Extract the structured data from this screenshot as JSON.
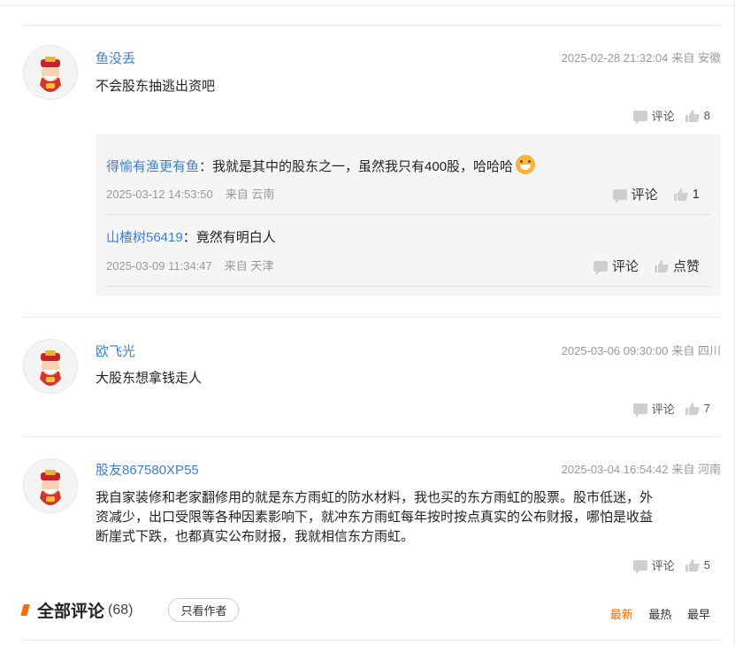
{
  "comments": [
    {
      "user": "鱼没丢",
      "time": "2025-02-28 21:32:04",
      "location": "来自 安徽",
      "text": "不会股东抽逃出资吧",
      "comment_label": "评论",
      "likes": "8",
      "replies": [
        {
          "user": "得愉有渔更有鱼",
          "text": "我就是其中的股东之一，虽然我只有400股，哈哈哈",
          "time": "2025-03-12 14:53:50",
          "location": "来自 云南",
          "comment_label": "评论",
          "likes": "1"
        },
        {
          "user": "山楂树56419",
          "text": "竟然有明白人",
          "time": "2025-03-09 11:34:47",
          "location": "来自 天津",
          "comment_label": "评论",
          "likes": "点赞"
        }
      ]
    },
    {
      "user": "欧飞光",
      "time": "2025-03-06 09:30:00",
      "location": "来自 四川",
      "text": "大股东想拿钱走人",
      "comment_label": "评论",
      "likes": "7"
    },
    {
      "user": "股友867580XP55",
      "time": "2025-03-04 16:54:42",
      "location": "来自 河南",
      "text_lines": [
        "我自家装修和老家翻修用的就是东方雨虹的防水材料，我也买的东方雨虹的股票。股市低迷，外",
        "资减少，出口受限等各种因素影响下，就冲东方雨虹每年按时按点真实的公布财报，哪怕是收益",
        "断崖式下跌，也都真实公布财报，我就相信东方雨虹。"
      ],
      "comment_label": "评论",
      "likes": "5"
    }
  ],
  "all_comments": {
    "title": "全部评论",
    "count": "(68)",
    "only_author": "只看作者",
    "sort": {
      "newest": "最新",
      "hottest": "最热",
      "earliest": "最早"
    }
  },
  "colors": {
    "username": "#3f7fcf",
    "accent": "#ff6a00",
    "reply_bg": "#f5f5f5"
  },
  "icons": {
    "avatar": "caishen-avatar-icon",
    "comment": "comment-bubble-icon",
    "like": "thumbs-up-icon",
    "emoji": "grinning-emoji-icon"
  }
}
